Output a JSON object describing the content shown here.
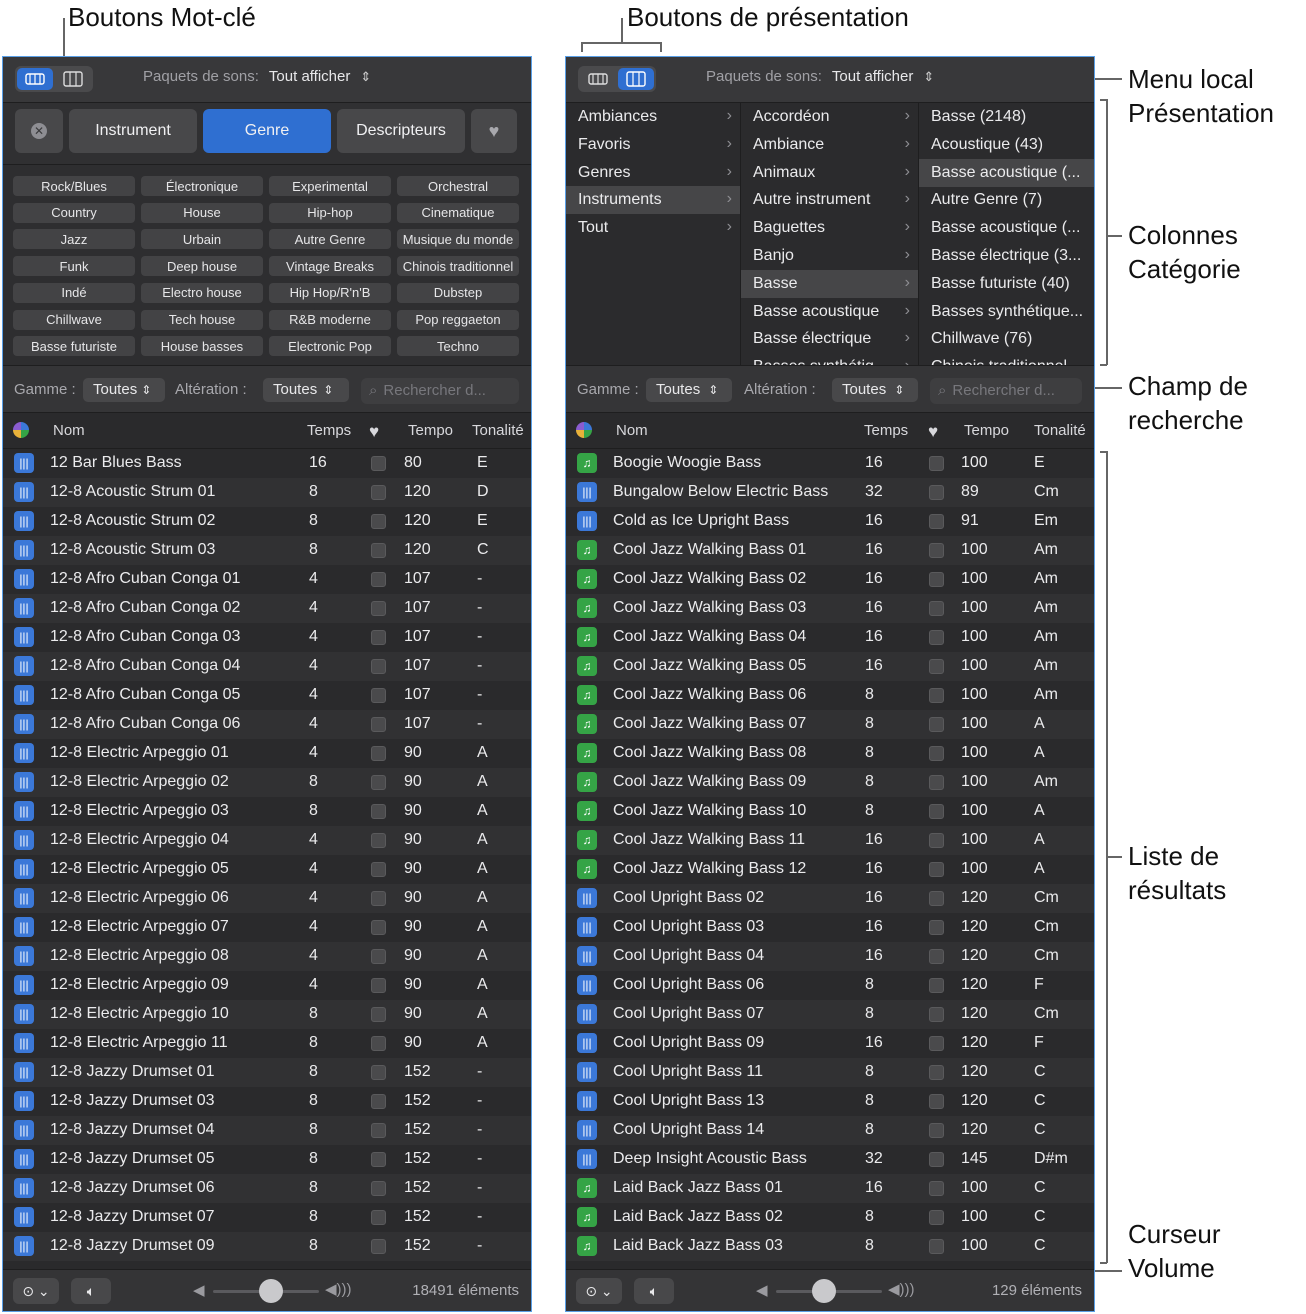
{
  "callouts": {
    "keyword_buttons": "Boutons Mot-clé",
    "view_buttons": "Boutons de présentation",
    "view_menu": [
      "Menu local",
      "Présentation"
    ],
    "category_columns": [
      "Colonnes",
      "Catégorie"
    ],
    "search_field": [
      "Champ de",
      "recherche"
    ],
    "results_list": [
      "Liste de",
      "résultats"
    ],
    "volume_slider": [
      "Curseur",
      "Volume"
    ]
  },
  "common": {
    "packs_label": "Paquets de sons:",
    "packs_value": "Tout afficher",
    "scale_label": "Gamme :",
    "scale_value": "Toutes",
    "sig_label": "Altération :",
    "sig_value": "Toutes",
    "search_placeholder": "Rechercher d...",
    "col_name": "Nom",
    "col_beats": "Temps",
    "col_tempo": "Tempo",
    "col_key": "Tonalité"
  },
  "left": {
    "tabs": [
      "Instrument",
      "Genre",
      "Descripteurs"
    ],
    "keywords": [
      [
        "Rock/Blues",
        "Électronique",
        "Experimental",
        "Orchestral"
      ],
      [
        "Country",
        "House",
        "Hip-hop",
        "Cinematique"
      ],
      [
        "Jazz",
        "Urbain",
        "Autre Genre",
        "Musique du monde"
      ],
      [
        "Funk",
        "Deep house",
        "Vintage Breaks",
        "Chinois traditionnel"
      ],
      [
        "Indé",
        "Electro house",
        "Hip Hop/R'n'B",
        "Dubstep"
      ],
      [
        "Chillwave",
        "Tech house",
        "R&B moderne",
        "Pop reggaeton"
      ],
      [
        "Basse futuriste",
        "House basses",
        "Electronic Pop",
        "Techno"
      ]
    ],
    "rows": [
      [
        "audio",
        "12 Bar Blues Bass",
        "16",
        "80",
        "E"
      ],
      [
        "audio",
        "12-8 Acoustic Strum 01",
        "8",
        "120",
        "D"
      ],
      [
        "audio",
        "12-8 Acoustic Strum 02",
        "8",
        "120",
        "E"
      ],
      [
        "audio",
        "12-8 Acoustic Strum 03",
        "8",
        "120",
        "C"
      ],
      [
        "audio",
        "12-8 Afro Cuban Conga 01",
        "4",
        "107",
        "-"
      ],
      [
        "audio",
        "12-8 Afro Cuban Conga 02",
        "4",
        "107",
        "-"
      ],
      [
        "audio",
        "12-8 Afro Cuban Conga 03",
        "4",
        "107",
        "-"
      ],
      [
        "audio",
        "12-8 Afro Cuban Conga 04",
        "4",
        "107",
        "-"
      ],
      [
        "audio",
        "12-8 Afro Cuban Conga 05",
        "4",
        "107",
        "-"
      ],
      [
        "audio",
        "12-8 Afro Cuban Conga 06",
        "4",
        "107",
        "-"
      ],
      [
        "audio",
        "12-8 Electric Arpeggio 01",
        "4",
        "90",
        "A"
      ],
      [
        "audio",
        "12-8 Electric Arpeggio 02",
        "8",
        "90",
        "A"
      ],
      [
        "audio",
        "12-8 Electric Arpeggio 03",
        "8",
        "90",
        "A"
      ],
      [
        "audio",
        "12-8 Electric Arpeggio 04",
        "4",
        "90",
        "A"
      ],
      [
        "audio",
        "12-8 Electric Arpeggio 05",
        "4",
        "90",
        "A"
      ],
      [
        "audio",
        "12-8 Electric Arpeggio 06",
        "4",
        "90",
        "A"
      ],
      [
        "audio",
        "12-8 Electric Arpeggio 07",
        "4",
        "90",
        "A"
      ],
      [
        "audio",
        "12-8 Electric Arpeggio 08",
        "4",
        "90",
        "A"
      ],
      [
        "audio",
        "12-8 Electric Arpeggio 09",
        "4",
        "90",
        "A"
      ],
      [
        "audio",
        "12-8 Electric Arpeggio 10",
        "8",
        "90",
        "A"
      ],
      [
        "audio",
        "12-8 Electric Arpeggio 11",
        "8",
        "90",
        "A"
      ],
      [
        "audio",
        "12-8 Jazzy Drumset 01",
        "8",
        "152",
        "-"
      ],
      [
        "audio",
        "12-8 Jazzy Drumset 03",
        "8",
        "152",
        "-"
      ],
      [
        "audio",
        "12-8 Jazzy Drumset 04",
        "8",
        "152",
        "-"
      ],
      [
        "audio",
        "12-8 Jazzy Drumset 05",
        "8",
        "152",
        "-"
      ],
      [
        "audio",
        "12-8 Jazzy Drumset 06",
        "8",
        "152",
        "-"
      ],
      [
        "audio",
        "12-8 Jazzy Drumset 07",
        "8",
        "152",
        "-"
      ],
      [
        "audio",
        "12-8 Jazzy Drumset 09",
        "8",
        "152",
        "-"
      ]
    ],
    "count": "18491 éléments",
    "volume": 0.55
  },
  "right": {
    "col1": [
      "Ambiances",
      "Favoris",
      "Genres",
      "Instruments",
      "Tout"
    ],
    "col2": [
      "Accordéon",
      "Ambiance",
      "Animaux",
      "Autre instrument",
      "Baguettes",
      "Banjo",
      "Basse",
      "Basse acoustique",
      "Basse électrique",
      "Basses synthétiq..."
    ],
    "col3": [
      "Basse (2148)",
      "Acoustique (43)",
      "Basse acoustique (...",
      "Autre Genre (7)",
      "Basse acoustique (...",
      "Basse électrique (3...",
      "Basse futuriste (40)",
      "Basses synthétique...",
      "Chillwave (76)",
      "Chinois traditionnel"
    ],
    "rows": [
      [
        "midi",
        "Boogie Woogie Bass",
        "16",
        "100",
        "E"
      ],
      [
        "audio",
        "Bungalow Below Electric Bass",
        "32",
        "89",
        "Cm"
      ],
      [
        "audio",
        "Cold as Ice Upright Bass",
        "16",
        "91",
        "Em"
      ],
      [
        "midi",
        "Cool Jazz Walking Bass 01",
        "16",
        "100",
        "Am"
      ],
      [
        "midi",
        "Cool Jazz Walking Bass 02",
        "16",
        "100",
        "Am"
      ],
      [
        "midi",
        "Cool Jazz Walking Bass 03",
        "16",
        "100",
        "Am"
      ],
      [
        "midi",
        "Cool Jazz Walking Bass 04",
        "16",
        "100",
        "Am"
      ],
      [
        "midi",
        "Cool Jazz Walking Bass 05",
        "16",
        "100",
        "Am"
      ],
      [
        "midi",
        "Cool Jazz Walking Bass 06",
        "8",
        "100",
        "Am"
      ],
      [
        "midi",
        "Cool Jazz Walking Bass 07",
        "8",
        "100",
        "A"
      ],
      [
        "midi",
        "Cool Jazz Walking Bass 08",
        "8",
        "100",
        "A"
      ],
      [
        "midi",
        "Cool Jazz Walking Bass 09",
        "8",
        "100",
        "Am"
      ],
      [
        "midi",
        "Cool Jazz Walking Bass 10",
        "8",
        "100",
        "A"
      ],
      [
        "midi",
        "Cool Jazz Walking Bass 11",
        "16",
        "100",
        "A"
      ],
      [
        "midi",
        "Cool Jazz Walking Bass 12",
        "16",
        "100",
        "A"
      ],
      [
        "audio",
        "Cool Upright Bass 02",
        "16",
        "120",
        "Cm"
      ],
      [
        "audio",
        "Cool Upright Bass 03",
        "16",
        "120",
        "Cm"
      ],
      [
        "audio",
        "Cool Upright Bass 04",
        "16",
        "120",
        "Cm"
      ],
      [
        "audio",
        "Cool Upright Bass 06",
        "8",
        "120",
        "F"
      ],
      [
        "audio",
        "Cool Upright Bass 07",
        "8",
        "120",
        "Cm"
      ],
      [
        "audio",
        "Cool Upright Bass 09",
        "16",
        "120",
        "F"
      ],
      [
        "audio",
        "Cool Upright Bass 11",
        "8",
        "120",
        "C"
      ],
      [
        "audio",
        "Cool Upright Bass 13",
        "8",
        "120",
        "C"
      ],
      [
        "audio",
        "Cool Upright Bass 14",
        "8",
        "120",
        "C"
      ],
      [
        "audio",
        "Deep Insight Acoustic Bass",
        "32",
        "145",
        "D#m"
      ],
      [
        "midi",
        "Laid Back Jazz Bass 01",
        "16",
        "100",
        "C"
      ],
      [
        "midi",
        "Laid Back Jazz Bass 02",
        "8",
        "100",
        "C"
      ],
      [
        "midi",
        "Laid Back Jazz Bass 03",
        "8",
        "100",
        "C"
      ]
    ],
    "count": "129 éléments",
    "volume": 0.45
  }
}
